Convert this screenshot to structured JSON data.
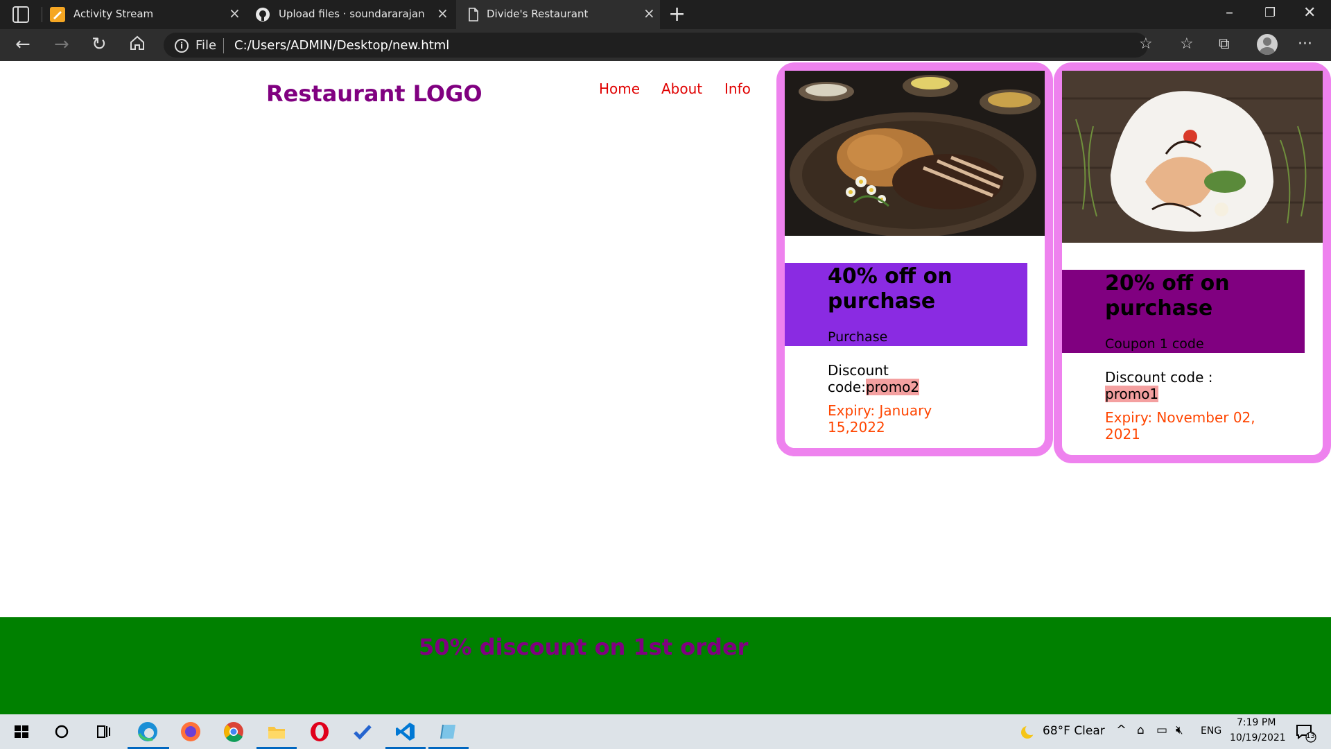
{
  "browser": {
    "tabs": [
      {
        "title": "Activity Stream"
      },
      {
        "title": "Upload files · soundararajanvign"
      },
      {
        "title": "Divide's Restaurant"
      }
    ],
    "address": {
      "scheme_label": "File",
      "url": "C:/Users/ADMIN/Desktop/new.html"
    }
  },
  "header": {
    "logo": "Restaurant LOGO",
    "nav": [
      "Home",
      "About",
      "Info"
    ]
  },
  "cards": [
    {
      "title": "40% off on purchase",
      "subtitle": "Purchase",
      "discount_label": "Discount code:",
      "code": "promo2",
      "expiry": "Expiry: January 15,2022",
      "box_color": "#8a2be2"
    },
    {
      "title": "20% off on purchase",
      "subtitle": "Coupon 1 code",
      "discount_label": "Discount code :",
      "code": "promo1",
      "expiry": "Expiry: November 02, 2021",
      "box_color": "#800080"
    }
  ],
  "footer": {
    "text": "50% discount on 1st order"
  },
  "taskbar": {
    "weather": "68°F  Clear",
    "lang": "ENG",
    "time": "7:19 PM",
    "date": "10/19/2021",
    "notifications": "13"
  },
  "colors": {
    "logo": "#800080",
    "nav": "#e00000",
    "card_border": "#ee82ee",
    "expiry": "#ff4500",
    "footer_bg": "#008000",
    "footer_text": "#800080"
  }
}
